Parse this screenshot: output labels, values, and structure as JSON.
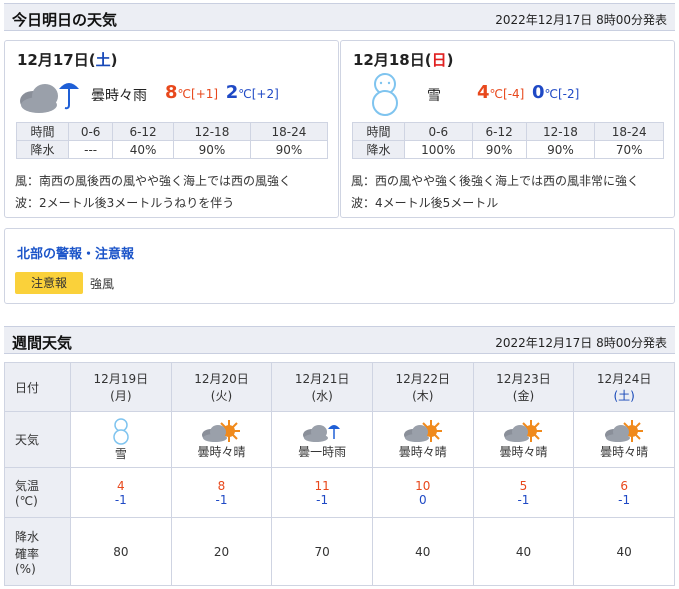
{
  "today_section": {
    "title": "今日明日の天気",
    "announced": "2022年12月17日 8時00分発表",
    "days": [
      {
        "date": "12月17日",
        "dow": "土",
        "icon": "cloudy-rain-icon",
        "weather": "曇時々雨",
        "high": "8",
        "high_unit": "℃[+1]",
        "low": "2",
        "low_unit": "℃[+2]",
        "rain_header": [
          "時間",
          "0-6",
          "6-12",
          "12-18",
          "18-24"
        ],
        "rain_row": [
          "降水",
          "---",
          "40%",
          "90%",
          "90%"
        ],
        "wind": "風：南西の風後西の風やや強く海上では西の風強く",
        "wave": "波：2メートル後3メートルうねりを伴う"
      },
      {
        "date": "12月18日",
        "dow": "日",
        "icon": "snowman-icon",
        "weather": "雪",
        "high": "4",
        "high_unit": "℃[-4]",
        "low": "0",
        "low_unit": "℃[-2]",
        "rain_header": [
          "時間",
          "0-6",
          "6-12",
          "12-18",
          "18-24"
        ],
        "rain_row": [
          "降水",
          "100%",
          "90%",
          "90%",
          "70%"
        ],
        "wind": "風：西の風やや強く後強く海上では西の風非常に強く",
        "wave": "波：4メートル後5メートル"
      }
    ]
  },
  "warnings": {
    "title": "北部の警報・注意報",
    "badge": "注意報",
    "value": "強風"
  },
  "weekly": {
    "title": "週間天気",
    "announced": "2022年12月17日 8時00分発表",
    "labels": {
      "date": "日付",
      "weather": "天気",
      "temp1": "気温",
      "temp2": "(℃)",
      "rain1": "降水",
      "rain2": "確率",
      "rain3": "(%)"
    },
    "days": [
      {
        "date": "12月19日",
        "dow": "(月)",
        "icon": "snowman-icon",
        "weather": "雪",
        "high": "4",
        "low": "-1",
        "rain": "80"
      },
      {
        "date": "12月20日",
        "dow": "(火)",
        "icon": "cloudy-sunny-icon",
        "weather": "曇時々晴",
        "high": "8",
        "low": "-1",
        "rain": "20"
      },
      {
        "date": "12月21日",
        "dow": "(水)",
        "icon": "cloudy-rain-icon",
        "weather": "曇一時雨",
        "high": "11",
        "low": "-1",
        "rain": "70"
      },
      {
        "date": "12月22日",
        "dow": "(木)",
        "icon": "cloudy-sunny-icon",
        "weather": "曇時々晴",
        "high": "10",
        "low": "0",
        "rain": "40"
      },
      {
        "date": "12月23日",
        "dow": "(金)",
        "icon": "cloudy-sunny-icon",
        "weather": "曇時々晴",
        "high": "5",
        "low": "-1",
        "rain": "40"
      },
      {
        "date": "12月24日",
        "dow": "(土)",
        "icon": "cloudy-sunny-icon",
        "weather": "曇時々晴",
        "high": "6",
        "low": "-1",
        "rain": "40"
      }
    ]
  },
  "colors": {
    "header_bg": "#eceef4",
    "high_temp": "#e8481c",
    "low_temp": "#1f49c5",
    "badge": "#fad13a",
    "saturday": "#1748b8",
    "sunday": "#e02020"
  }
}
